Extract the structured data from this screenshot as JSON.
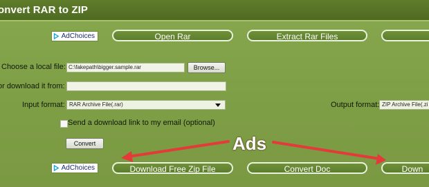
{
  "header": {
    "title": "onvert RAR to ZIP"
  },
  "ads": {
    "adchoices_label": "AdChoices",
    "top_links": [
      "Open Rar",
      "Extract Rar Files",
      ""
    ],
    "bottom_links": [
      "Download Free Zip File",
      "Convert Doc",
      "Down"
    ],
    "annotation_text": "Ads",
    "annotation_color": "#e33a3a"
  },
  "form": {
    "local_file_label": "Choose a local file:",
    "local_file_value": "C:\\fakepath\\bigger.sample.rar",
    "browse_label": "Browse...",
    "download_from_label": "or download it from:",
    "download_from_value": "",
    "input_format_label": "Input format:",
    "input_format_value": "RAR Archive File(.rar)",
    "output_format_label": "Output format:",
    "output_format_value": "ZIP Archive File(.zi",
    "email_checkbox_label": "Send a download link to my email (optional)",
    "convert_label": "Convert"
  },
  "colors": {
    "header_bg": "#56742a",
    "page_bg": "#7f9f47",
    "pill_border": "#e9f2dc"
  },
  "icons": {
    "adchoices_icon": "adchoices-triangle-icon",
    "select_arrow": "chevron-down-icon"
  }
}
